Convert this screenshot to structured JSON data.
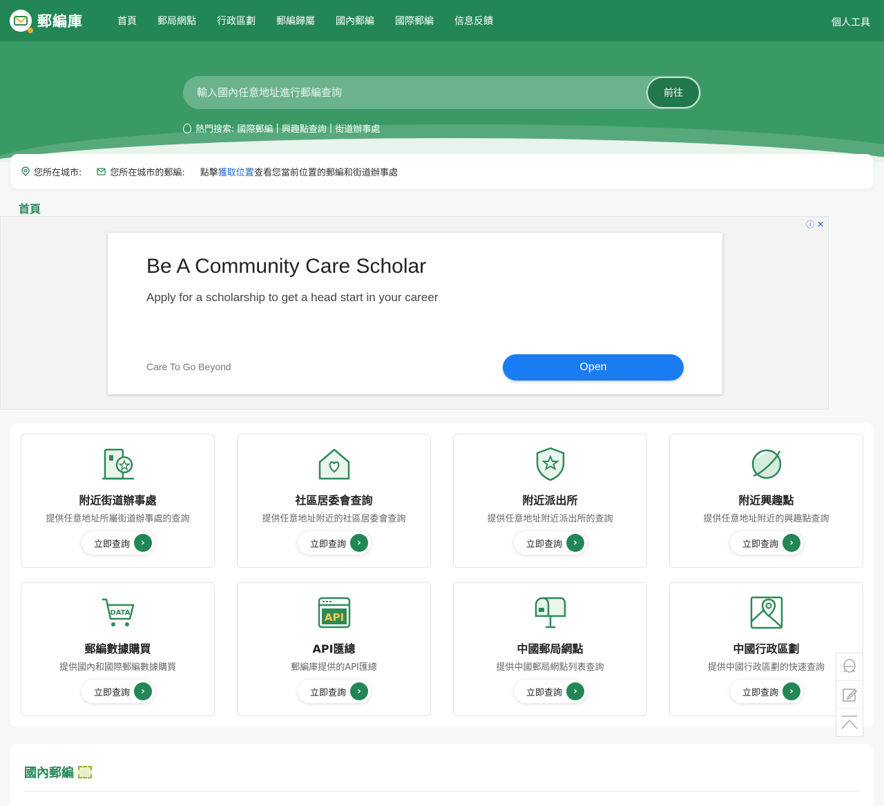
{
  "header": {
    "logo_text": "郵編庫",
    "nav": [
      "首頁",
      "郵局網點",
      "行政區劃",
      "郵編歸屬",
      "國內郵編",
      "國際郵編",
      "信息反饋"
    ],
    "right_label": "個人工具"
  },
  "search": {
    "placeholder": "輸入國內任意地址進行郵編查詢",
    "button": "前往",
    "hot_label": "熱門搜索:",
    "hot_links": [
      "國際郵編",
      "興趣點查詢",
      "街道辦事處"
    ],
    "separator": "|"
  },
  "location": {
    "city_label": "您所在城市:",
    "zip_label": "您所在城市的郵編:",
    "hint_prefix": "點擊",
    "hint_link": "獲取位置",
    "hint_suffix": "查看您當前位置的郵編和街道辦事處"
  },
  "breadcrumb": "首頁",
  "ad": {
    "title": "Be A Community Care Scholar",
    "subtitle": "Apply for a scholarship to get a head start in your career",
    "brand": "Care To Go Beyond",
    "button": "Open",
    "icons": "ⓘ ✕"
  },
  "services": [
    {
      "title": "附近街道辦事處",
      "desc": "提供任意地址所屬街道辦事處的查詢",
      "button": "立即查詢",
      "icon": "building-badge-icon"
    },
    {
      "title": "社區居委會查詢",
      "desc": "提供任意地址附近的社區居委會查詢",
      "button": "立即查詢",
      "icon": "house-heart-icon"
    },
    {
      "title": "附近派出所",
      "desc": "提供任意地址附近派出所的查詢",
      "button": "立即查詢",
      "icon": "police-shield-icon"
    },
    {
      "title": "附近興趣點",
      "desc": "提供任意地址附近的興趣點查詢",
      "button": "立即查詢",
      "icon": "planet-icon"
    },
    {
      "title": "郵編數據購買",
      "desc": "提供國內和國際郵編數據購買",
      "button": "立即查詢",
      "icon": "data-cart-icon",
      "icon_text": "DATA"
    },
    {
      "title": "API匯總",
      "desc": "郵編庫提供的API匯總",
      "button": "立即查詢",
      "icon": "api-window-icon",
      "icon_text": "API"
    },
    {
      "title": "中國郵局網點",
      "desc": "提供中國郵局網點列表查詢",
      "button": "立即查詢",
      "icon": "mailbox-icon"
    },
    {
      "title": "中國行政區劃",
      "desc": "提供中國行政區劃的快速查詢",
      "button": "立即查詢",
      "icon": "map-pin-icon"
    }
  ],
  "side_tools": [
    "chat-icon",
    "edit-icon",
    "back-to-top-icon"
  ],
  "bottom": {
    "title": "國內郵編"
  },
  "colors": {
    "primary": "#238655",
    "hero": "#3a9a66",
    "ad_button": "#1a7cf2",
    "link": "#1a66c7"
  }
}
